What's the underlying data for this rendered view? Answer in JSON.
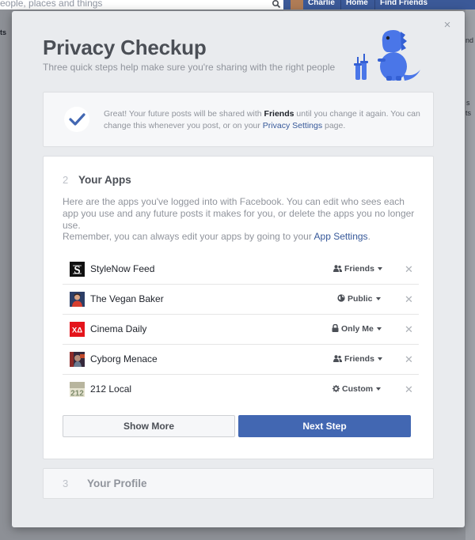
{
  "top_bar": {
    "search_placeholder": "eople, places and things",
    "user_name": "Charlie",
    "nav_home": "Home",
    "nav_find_friends": "Find Friends"
  },
  "background": {
    "left_snippet": "ts",
    "right_snippets": [
      "nd 2",
      "s",
      "ts"
    ]
  },
  "dialog": {
    "title": "Privacy Checkup",
    "subtitle": "Three quick steps help make sure you're sharing with the right people",
    "confirmation": {
      "prefix": "Great! Your future posts will be shared with ",
      "audience": "Friends",
      "middle": " until you change it again. You can change this whenever you post, or on your ",
      "link": "Privacy Settings",
      "suffix": " page."
    },
    "apps_step": {
      "number": "2",
      "title": "Your Apps",
      "description": "Here are the apps you've logged into with Facebook. You can edit who sees each app you use and any future posts it makes for you, or delete the apps you no longer use.",
      "remember_prefix": "Remember, you can always edit your apps by going to your ",
      "remember_link": "App Settings",
      "remember_suffix": ".",
      "apps": [
        {
          "name": "StyleNow Feed",
          "audience": "Friends",
          "audience_icon": "friends-icon"
        },
        {
          "name": "The Vegan Baker",
          "audience": "Public",
          "audience_icon": "globe-icon"
        },
        {
          "name": "Cinema Daily",
          "audience": "Only Me",
          "audience_icon": "lock-icon"
        },
        {
          "name": "Cyborg Menace",
          "audience": "Friends",
          "audience_icon": "friends-icon"
        },
        {
          "name": "212 Local",
          "audience": "Custom",
          "audience_icon": "gear-icon"
        }
      ],
      "app_icon_text": {
        "cinema": "XΔ",
        "local": "212"
      },
      "show_more": "Show More",
      "next_step": "Next Step"
    },
    "profile_step": {
      "number": "3",
      "title": "Your Profile"
    }
  },
  "colors": {
    "facebook_blue": "#3b5998",
    "button_blue": "#4267b2",
    "link_blue": "#365899",
    "mascot_blue": "#4a76e8"
  }
}
